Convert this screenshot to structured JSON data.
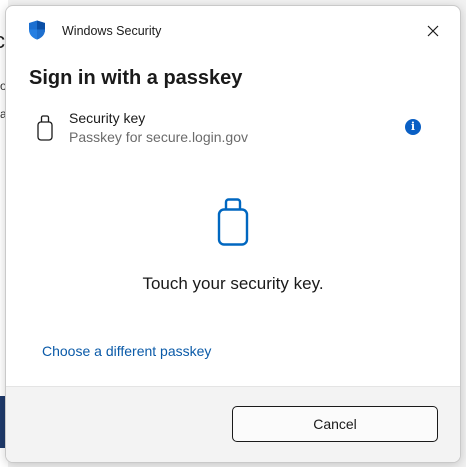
{
  "window": {
    "title": "Windows Security",
    "close_icon": "close-icon",
    "app_icon": "shield-icon"
  },
  "dialog": {
    "heading": "Sign in with a passkey",
    "credential": {
      "icon": "security-key-icon",
      "title": "Security key",
      "subtitle": "Passkey for secure.login.gov",
      "info_icon": "info-icon"
    },
    "prompt_icon": "security-key-icon",
    "prompt": "Touch your security key.",
    "alternate_link": "Choose a different passkey",
    "cancel_label": "Cancel"
  },
  "colors": {
    "accent": "#0a5fc4",
    "link": "#0a5aa8",
    "icon_blue": "#0067c0",
    "background": "#ffffff",
    "footer": "#f3f3f3"
  }
}
